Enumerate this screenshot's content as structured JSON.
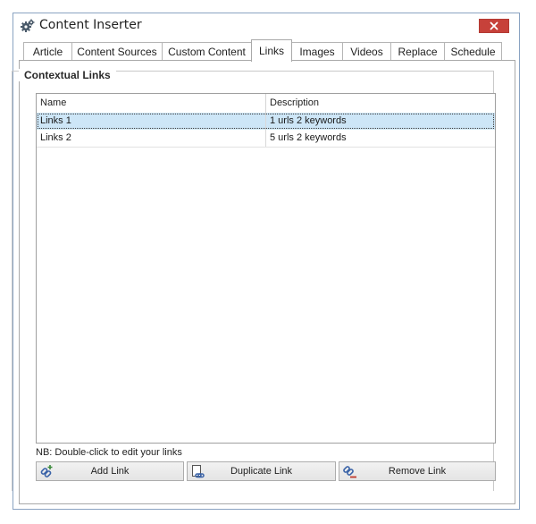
{
  "window": {
    "title": "Content Inserter"
  },
  "tabs": [
    {
      "label": "Article"
    },
    {
      "label": "Content Sources"
    },
    {
      "label": "Custom Content"
    },
    {
      "label": "Links",
      "active": true
    },
    {
      "label": "Images"
    },
    {
      "label": "Videos"
    },
    {
      "label": "Replace"
    },
    {
      "label": "Schedule"
    }
  ],
  "group": {
    "title": "Contextual Links"
  },
  "grid": {
    "columns": [
      "Name",
      "Description"
    ],
    "rows": [
      {
        "name": "Links 1",
        "description": "1 urls 2 keywords",
        "selected": true
      },
      {
        "name": "Links 2",
        "description": "5 urls 2 keywords",
        "selected": false
      }
    ]
  },
  "note": "NB: Double-click to edit your links",
  "buttons": {
    "add": "Add Link",
    "duplicate": "Duplicate Link",
    "remove": "Remove Link"
  },
  "icons": {
    "app": "gear-icon",
    "close": "close-icon",
    "add": "add-link-icon",
    "duplicate": "duplicate-link-icon",
    "remove": "remove-link-icon"
  },
  "colors": {
    "close_button": "#c7413a",
    "selection": "#cde6f7",
    "window_border": "#8aa3c2"
  }
}
